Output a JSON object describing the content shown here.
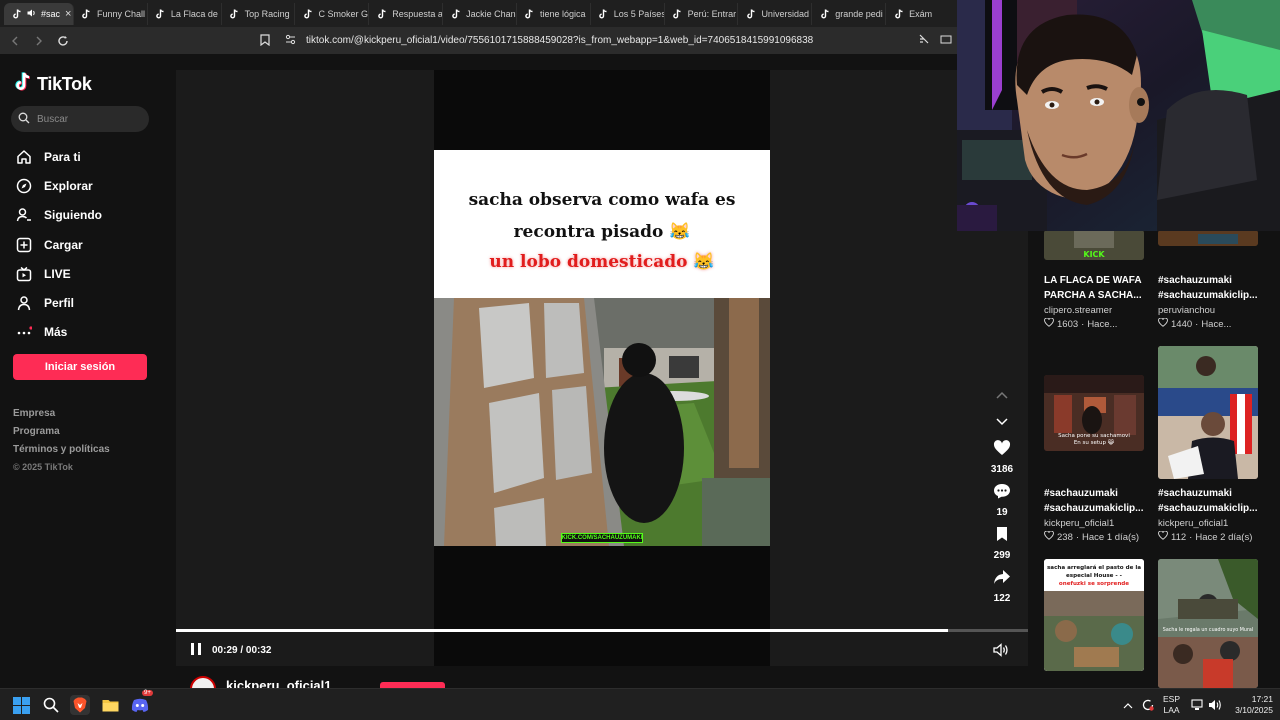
{
  "browser": {
    "tabs": [
      {
        "label": "#sac"
      },
      {
        "label": "Funny Chall"
      },
      {
        "label": "La Flaca de"
      },
      {
        "label": "Top Racing"
      },
      {
        "label": "C Smoker G"
      },
      {
        "label": "Respuesta a"
      },
      {
        "label": "Jackie Chan"
      },
      {
        "label": "tiene lógica"
      },
      {
        "label": "Los 5 Países"
      },
      {
        "label": "Perú: Entrar"
      },
      {
        "label": "Universidad"
      },
      {
        "label": "grande pedi"
      },
      {
        "label": "Exám"
      }
    ],
    "close_glyph": "×",
    "url": "tiktok.com/@kickperu_oficial1/video/7556101715888459028?is_from_webapp=1&web_id=7406518415991096838"
  },
  "sidebar": {
    "logo_text": "TikTok",
    "search_placeholder": "Buscar",
    "nav": [
      {
        "label": "Para ti",
        "icon": "home-icon"
      },
      {
        "label": "Explorar",
        "icon": "compass-icon"
      },
      {
        "label": "Siguiendo",
        "icon": "user-follow-icon"
      },
      {
        "label": "Cargar",
        "icon": "upload-plus-icon"
      },
      {
        "label": "LIVE",
        "icon": "live-tv-icon"
      },
      {
        "label": "Perfil",
        "icon": "profile-icon"
      },
      {
        "label": "Más",
        "icon": "more-dots-icon"
      }
    ],
    "login_label": "Iniciar sesión",
    "footer": {
      "empresa": "Empresa",
      "programa": "Programa",
      "terminos": "Términos y políticas",
      "copyright": "© 2025 TikTok"
    }
  },
  "video": {
    "caption_line1": "sacha observa como wafa es",
    "caption_line2": "recontra pisado 😹",
    "caption_line3": "un lobo domesticado 😹",
    "watermark": "KICK.COM/SACHAUZUMAKI",
    "likes": "3186",
    "comments": "19",
    "saves": "299",
    "shares": "122",
    "time": "00:29 / 00:32",
    "progress": 0.906,
    "author": "kickperu_oficial1"
  },
  "related": [
    {
      "title1": "LA FLACA DE WAFA",
      "title2": "PARCHA A SACHA...",
      "author": "clipero.streamer",
      "likes": "1603",
      "age": "Hace..."
    },
    {
      "title1": "#sachauzumaki",
      "title2": "#sachauzumakiclip...",
      "author": "peruvianchou",
      "likes": "1440",
      "age": "Hace..."
    },
    {
      "title1": "#sachauzumaki",
      "title2": "#sachauzumakiclip...",
      "author": "kickperu_oficial1",
      "likes": "238",
      "age": "Hace 1 día(s)"
    },
    {
      "title1": "#sachauzumaki",
      "title2": "#sachauzumakiclip...",
      "author": "kickperu_oficial1",
      "likes": "112",
      "age": "Hace 2 día(s)"
    }
  ],
  "thumb_texts": {
    "kick_label": "KICK",
    "sacha_setup": "Sacha pone su sachamovi En su setup 😹",
    "sacha_pasto_1": "sacha arreglará el pasto de la",
    "sacha_pasto_2": "especial House - -",
    "sacha_pasto_3": "onefuzki se sorprende",
    "sacha_mural": "Sacha le regala un cuadro suyo Mural"
  },
  "taskbar": {
    "lang1": "ESP",
    "lang2": "LAA",
    "time": "17:21",
    "date": "3/10/2025",
    "discord_badge": "9+"
  },
  "colors": {
    "accent": "#fe2c55",
    "kick_green": "#53fc18"
  }
}
